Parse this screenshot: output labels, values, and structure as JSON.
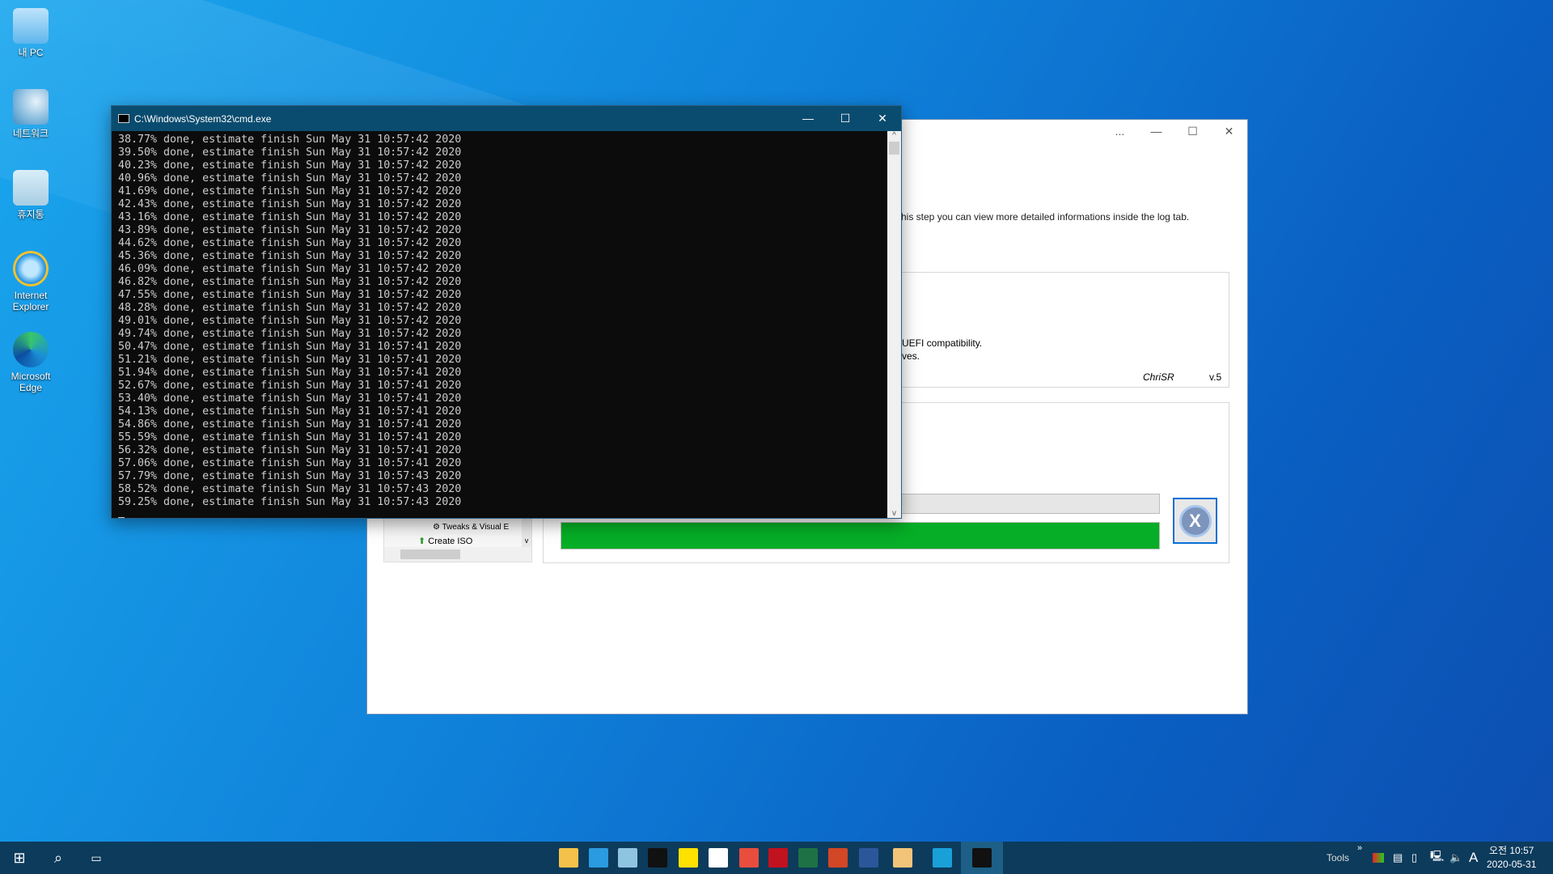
{
  "desktop": {
    "icons": [
      {
        "label": "내 PC",
        "icon": "computer-icon"
      },
      {
        "label": "네트워크",
        "icon": "network-icon"
      },
      {
        "label": "휴지통",
        "icon": "recycle-bin-icon"
      },
      {
        "label": "Internet Explorer",
        "icon": "ie-icon"
      },
      {
        "label": "Microsoft Edge",
        "icon": "edge-icon"
      }
    ]
  },
  "app": {
    "ctrl_dots": "...",
    "desc": "his step you can view more detailed informations inside the log tab.",
    "line1": "UEFI compatibility.",
    "line2": "ves.",
    "author": "ChriSR",
    "version": "v.5",
    "tree": {
      "items": [
        "Tweaks & Visual E",
        "Create ISO"
      ]
    },
    "progress_percent": 100,
    "progress_color": "#06ad26"
  },
  "cmd": {
    "title": "C:\\Windows\\System32\\cmd.exe",
    "lines": [
      "38.77% done, estimate finish Sun May 31 10:57:42 2020",
      "39.50% done, estimate finish Sun May 31 10:57:42 2020",
      "40.23% done, estimate finish Sun May 31 10:57:42 2020",
      "40.96% done, estimate finish Sun May 31 10:57:42 2020",
      "41.69% done, estimate finish Sun May 31 10:57:42 2020",
      "42.43% done, estimate finish Sun May 31 10:57:42 2020",
      "43.16% done, estimate finish Sun May 31 10:57:42 2020",
      "43.89% done, estimate finish Sun May 31 10:57:42 2020",
      "44.62% done, estimate finish Sun May 31 10:57:42 2020",
      "45.36% done, estimate finish Sun May 31 10:57:42 2020",
      "46.09% done, estimate finish Sun May 31 10:57:42 2020",
      "46.82% done, estimate finish Sun May 31 10:57:42 2020",
      "47.55% done, estimate finish Sun May 31 10:57:42 2020",
      "48.28% done, estimate finish Sun May 31 10:57:42 2020",
      "49.01% done, estimate finish Sun May 31 10:57:42 2020",
      "49.74% done, estimate finish Sun May 31 10:57:42 2020",
      "50.47% done, estimate finish Sun May 31 10:57:41 2020",
      "51.21% done, estimate finish Sun May 31 10:57:41 2020",
      "51.94% done, estimate finish Sun May 31 10:57:41 2020",
      "52.67% done, estimate finish Sun May 31 10:57:41 2020",
      "53.40% done, estimate finish Sun May 31 10:57:41 2020",
      "54.13% done, estimate finish Sun May 31 10:57:41 2020",
      "54.86% done, estimate finish Sun May 31 10:57:41 2020",
      "55.59% done, estimate finish Sun May 31 10:57:41 2020",
      "56.32% done, estimate finish Sun May 31 10:57:41 2020",
      "57.06% done, estimate finish Sun May 31 10:57:41 2020",
      "57.79% done, estimate finish Sun May 31 10:57:43 2020",
      "58.52% done, estimate finish Sun May 31 10:57:43 2020",
      "59.25% done, estimate finish Sun May 31 10:57:43 2020"
    ]
  },
  "taskbar": {
    "apps": [
      {
        "icon": "file-explorer-icon",
        "color": "#f4c24a"
      },
      {
        "icon": "maps-icon",
        "color": "#2a9be0"
      },
      {
        "icon": "notepad-icon",
        "color": "#8fc4e0"
      },
      {
        "icon": "cmd-icon",
        "color": "#111111"
      },
      {
        "icon": "sticky-notes-icon",
        "color": "#ffe100"
      },
      {
        "icon": "calculator-icon",
        "color": "#ffffff"
      },
      {
        "icon": "snipping-icon",
        "color": "#e84d3d"
      },
      {
        "icon": "pdf-icon",
        "color": "#c1121f"
      },
      {
        "icon": "excel-icon",
        "color": "#1e7145"
      },
      {
        "icon": "powerpoint-icon",
        "color": "#d24726"
      },
      {
        "icon": "word-icon",
        "color": "#2b579a"
      },
      {
        "icon": "tools-app-icon",
        "color": "#f2c47a"
      },
      {
        "icon": "edge-icon",
        "color": "#1aa0d8"
      },
      {
        "icon": "cmd-icon",
        "color": "#111111"
      }
    ],
    "tools_label": "Tools",
    "chevron": "»",
    "ime": "A",
    "time": "오전 10:57",
    "date": "2020-05-31"
  }
}
